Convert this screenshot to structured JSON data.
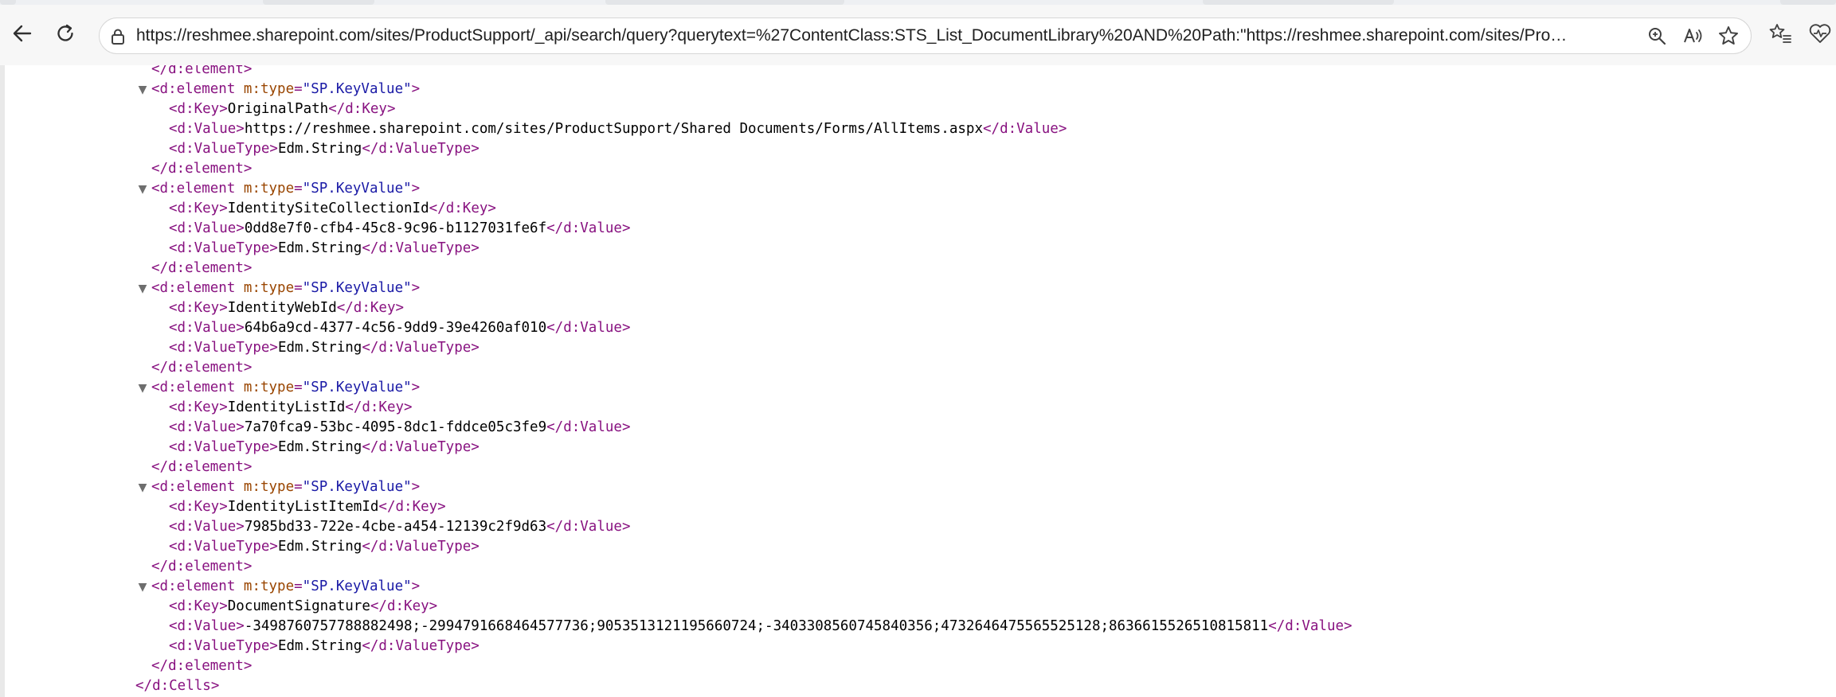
{
  "browser": {
    "url": "https://reshmee.sharepoint.com/sites/ProductSupport/_api/search/query?querytext=%27ContentClass:STS_List_DocumentLibrary%20AND%20Path:\"https://reshmee.sharepoint.com/sites/ProductSuppor...",
    "icons": {
      "back": "arrow-left-icon",
      "reload": "reload-icon",
      "lock": "lock-icon",
      "zoom": "zoom-icon",
      "read_aloud": "read-aloud-icon",
      "favorite": "star-icon",
      "favorites": "favorites-icon",
      "health": "browser-essentials-icon"
    }
  },
  "xml": {
    "open": "<",
    "close": ">",
    "end_open": "</",
    "element_tag": "d:element",
    "type_attr": "m:type",
    "eq": "=",
    "type_value": "\"SP.KeyValue\"",
    "key_tag": "d:Key",
    "value_tag": "d:Value",
    "valuetype_tag": "d:ValueType",
    "cells_tag": "d:Cells",
    "collapse_glyph": "▼",
    "items": [
      {
        "key": "OriginalPath",
        "value": "https://reshmee.sharepoint.com/sites/ProductSupport/Shared Documents/Forms/AllItems.aspx",
        "type": "Edm.String"
      },
      {
        "key": "IdentitySiteCollectionId",
        "value": "0dd8e7f0-cfb4-45c8-9c96-b1127031fe6f",
        "type": "Edm.String"
      },
      {
        "key": "IdentityWebId",
        "value": "64b6a9cd-4377-4c56-9dd9-39e4260af010",
        "type": "Edm.String"
      },
      {
        "key": "IdentityListId",
        "value": "7a70fca9-53bc-4095-8dc1-fddce05c3fe9",
        "type": "Edm.String"
      },
      {
        "key": "IdentityListItemId",
        "value": "7985bd33-722e-4cbe-a454-12139c2f9d63",
        "type": "Edm.String"
      },
      {
        "key": "DocumentSignature",
        "value": "-3498760757788882498;-2994791668464577736;9053513121195660724;-3403308560745840356;4732646475565525128;8636615526510815811",
        "type": "Edm.String"
      }
    ]
  }
}
